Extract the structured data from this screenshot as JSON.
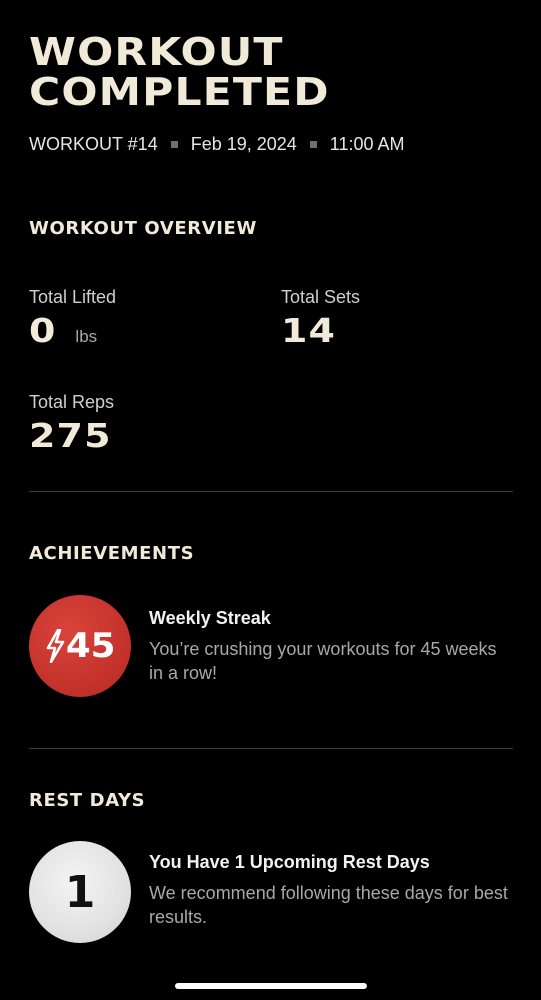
{
  "header": {
    "title_line1": "WORKOUT",
    "title_line2": "COMPLETED",
    "workout_number": "WORKOUT #14",
    "date": "Feb 19, 2024",
    "time": "11:00 AM"
  },
  "overview": {
    "heading": "WORKOUT OVERVIEW",
    "total_lifted_label": "Total Lifted",
    "total_lifted_value": "0",
    "total_lifted_unit": "lbs",
    "total_sets_label": "Total Sets",
    "total_sets_value": "14",
    "total_reps_label": "Total Reps",
    "total_reps_value": "275"
  },
  "achievements": {
    "heading": "ACHIEVEMENTS",
    "badge_value": "45",
    "title": "Weekly Streak",
    "description": "You’re crushing your workouts for 45 weeks in a row!"
  },
  "rest_days": {
    "heading": "REST DAYS",
    "badge_value": "1",
    "title": "You Have 1 Upcoming Rest Days",
    "description": "We recommend following these days for best results."
  },
  "colors": {
    "background": "#000000",
    "heading_cream": "#f2ead8",
    "streak_red": "#c5332c",
    "rest_badge_white": "#e2e2e2"
  },
  "icons": {
    "streak_icon": "lightning-bolt-icon"
  }
}
